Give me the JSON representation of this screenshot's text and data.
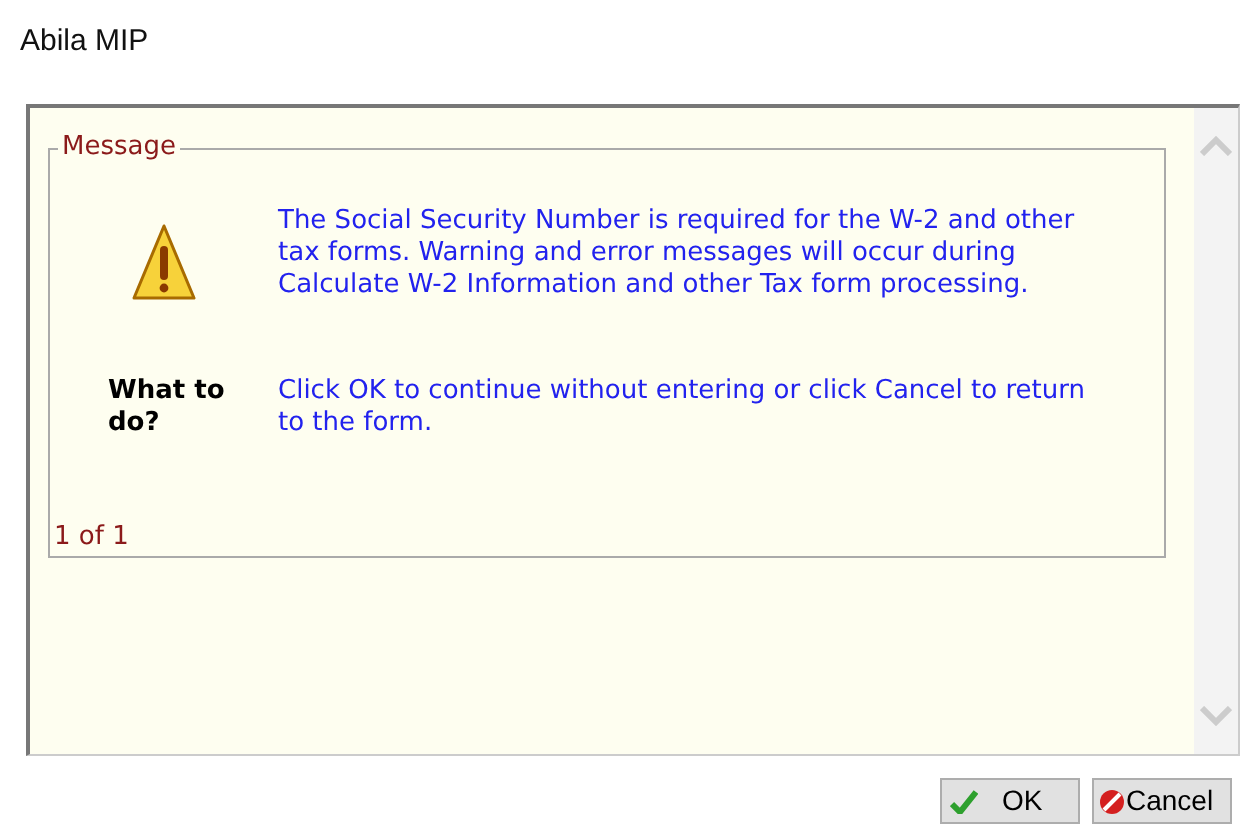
{
  "window": {
    "title": "Abila MIP"
  },
  "message_box": {
    "legend": "Message",
    "message": "The Social Security Number is required for the W-2 and other tax forms. Warning and error messages will occur during Calculate W-2 Information and other Tax form processing.",
    "prompt_label": "What to do?",
    "instruction": "Click OK to continue without entering or click Cancel to return to the form.",
    "pager": "1 of 1"
  },
  "buttons": [
    {
      "label": "OK",
      "kind": "ok"
    },
    {
      "label": "Cancel",
      "kind": "cancel"
    }
  ]
}
